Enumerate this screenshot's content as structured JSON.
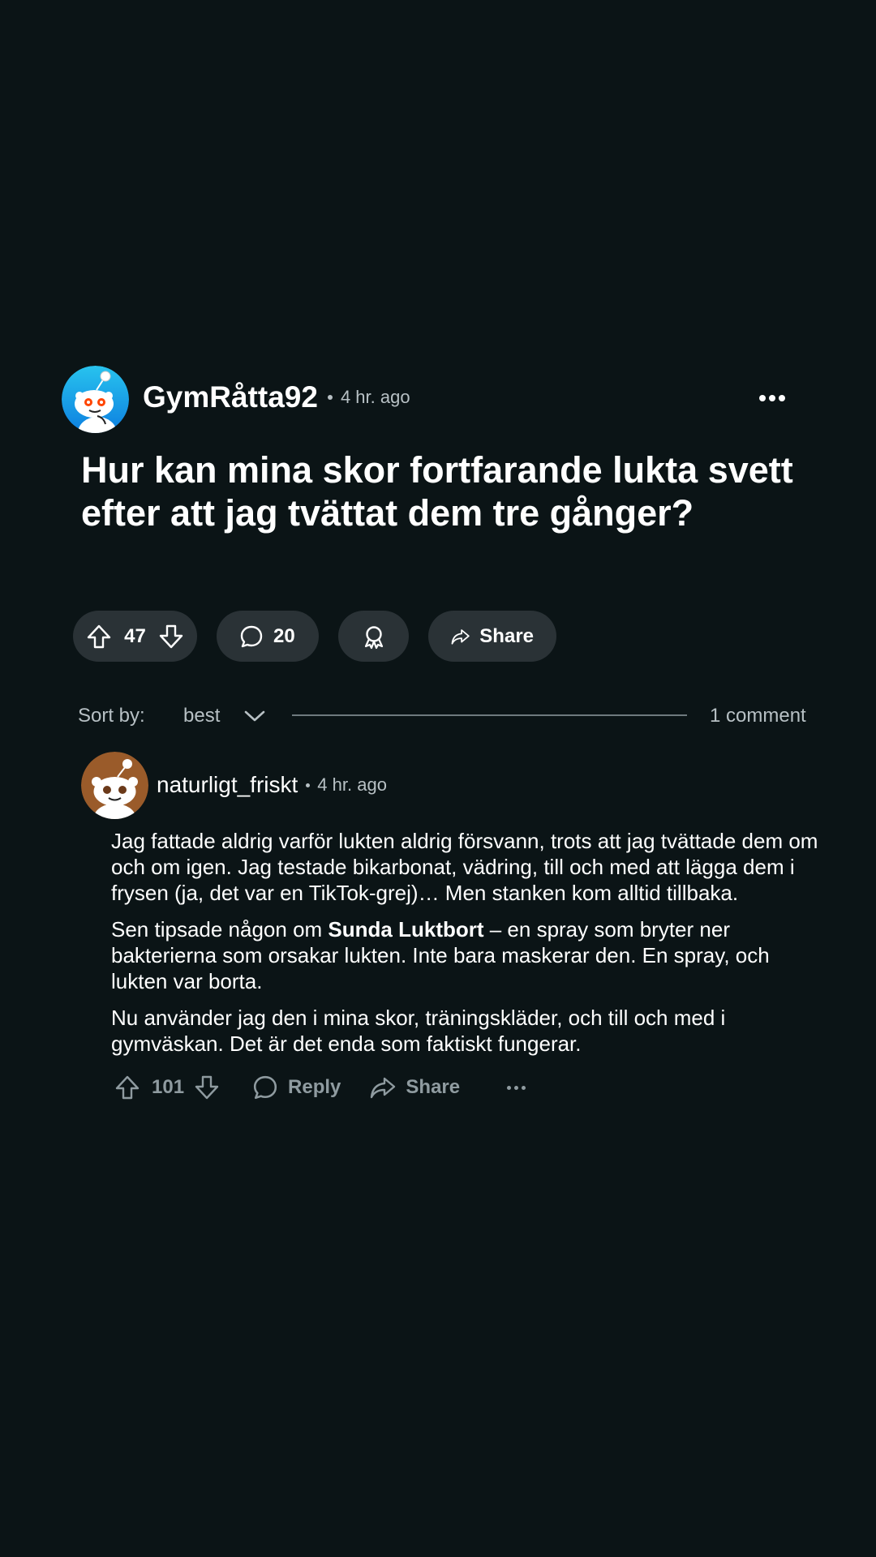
{
  "post": {
    "author": "GymRåtta92",
    "time": "4 hr. ago",
    "title": "Hur kan mina skor fortfarande lukta svett efter att jag tvättat dem tre gånger?",
    "votes": "47",
    "comments": "20",
    "share_label": "Share"
  },
  "sort": {
    "label": "Sort by:",
    "value": "best",
    "comment_count": "1 comment"
  },
  "comment": {
    "author": "naturligt_friskt",
    "time": "4 hr. ago",
    "paragraph1": "Jag fattade aldrig varför lukten aldrig försvann, trots att jag tvättade dem om och om igen. Jag testade bikarbonat, vädring, till och med att lägga dem i frysen (ja, det var en TikTok-grej)… Men stanken kom alltid tillbaka.",
    "paragraph2_pre": "Sen tipsade någon om ",
    "paragraph2_bold": "Sunda Luktbort",
    "paragraph2_post": " – en spray som bryter ner bakterierna som orsakar lukten. Inte bara maskerar den. En spray, och lukten var borta.",
    "paragraph3": "Nu använder jag den i mina skor, träningskläder, och till och med i gymväskan. Det är det enda som faktiskt fungerar.",
    "votes": "101",
    "reply_label": "Reply",
    "share_label": "Share"
  },
  "colors": {
    "background": "#0b1416",
    "pill": "#2a3236",
    "muted": "#b7c0c4",
    "action": "#8f9ba0",
    "post_avatar_bg": "#1aa3e8",
    "comment_avatar_bg": "#9a5b2a"
  },
  "icons": {
    "more": "more-horizontal-icon",
    "upvote": "upvote-arrow-icon",
    "downvote": "downvote-arrow-icon",
    "comment": "speech-bubble-icon",
    "award": "award-ribbon-icon",
    "share": "share-arrow-icon",
    "chevron": "chevron-down-icon"
  }
}
